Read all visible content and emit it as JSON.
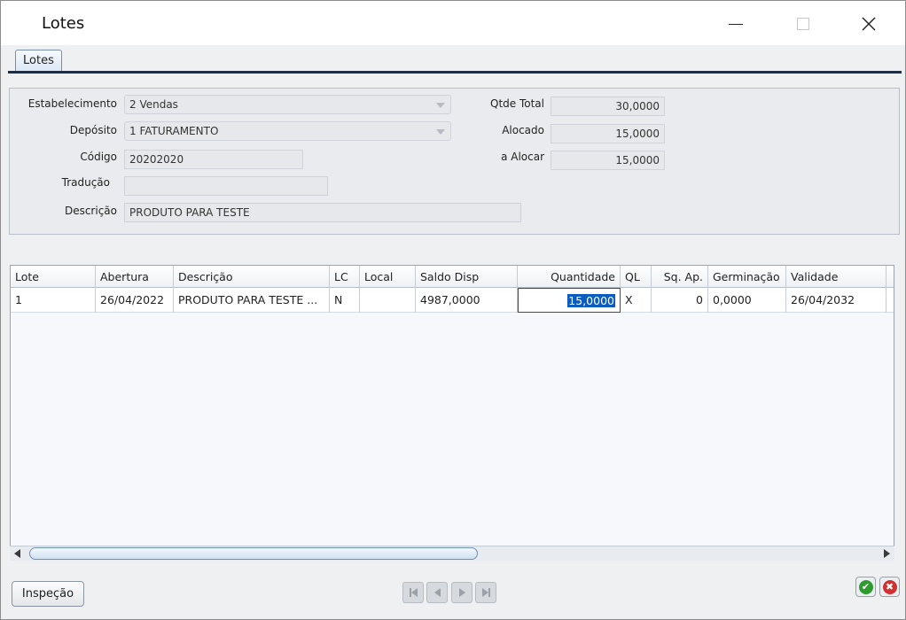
{
  "window": {
    "title": "Lotes"
  },
  "tabs": [
    {
      "label": "Lotes"
    }
  ],
  "form": {
    "estabelecimento": {
      "label": "Estabelecimento",
      "value": "2 Vendas"
    },
    "deposito": {
      "label": "Depósito",
      "value": "1 FATURAMENTO"
    },
    "codigo": {
      "label": "Código",
      "value": "20202020"
    },
    "traducao": {
      "label": "Tradução",
      "value": ""
    },
    "descricao": {
      "label": "Descrição",
      "value": "PRODUTO PARA TESTE"
    },
    "qtde_total": {
      "label": "Qtde Total",
      "value": "30,0000"
    },
    "alocado": {
      "label": "Alocado",
      "value": "15,0000"
    },
    "a_alocar": {
      "label": "a Alocar",
      "value": "15,0000"
    }
  },
  "grid": {
    "columns": [
      "Lote",
      "Abertura",
      "Descrição",
      "LC",
      "Local",
      "Saldo Disp",
      "Quantidade",
      "QL",
      "Sq. Ap.",
      "Germinação",
      "Validade"
    ],
    "rows": [
      {
        "lote": "1",
        "abertura": "26/04/2022",
        "descricao": "PRODUTO PARA TESTE  ...",
        "lc": "N",
        "local": "",
        "saldo_disp": "4987,0000",
        "quantidade": "15,0000",
        "ql": "X",
        "sq_ap": "0",
        "germinacao": "0,0000",
        "validade": "26/04/2032"
      }
    ]
  },
  "buttons": {
    "inspecao": "Inspeção",
    "ok_symbol": "✔",
    "cancel_symbol": "✖"
  },
  "icons": {
    "minimize": "minimize-icon",
    "maximize": "maximize-icon",
    "close": "close-icon",
    "nav_first": "first-record-icon",
    "nav_prev": "previous-record-icon",
    "nav_next": "next-record-icon",
    "nav_last": "last-record-icon",
    "ok": "confirm-icon",
    "cancel": "cancel-icon"
  },
  "colors": {
    "selection": "#0a5dbf",
    "ok": "#2e9b2e",
    "cancel": "#d13030",
    "tab_underline": "#1e2c44"
  }
}
